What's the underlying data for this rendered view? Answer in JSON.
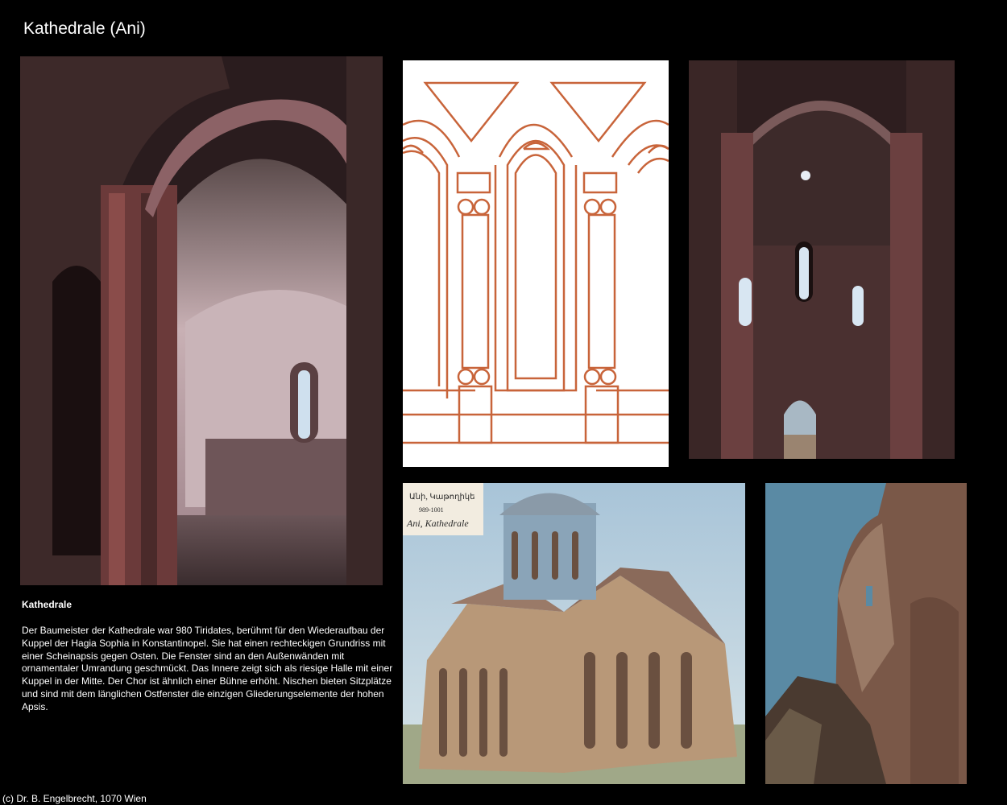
{
  "page": {
    "title": "Kathedrale (Ani)"
  },
  "images": {
    "interior_apse": "interior-apse-photo",
    "arch_drawing": "arch-drawing",
    "interior_nave": "interior-nave-photo",
    "reconstruction": "reconstruction-painting",
    "ruin": "ruin-photo"
  },
  "painting": {
    "label_line1": "Անի, Կաթողիկե",
    "label_line2": "989-1001",
    "label_line3": "Ani, Kathedrale"
  },
  "caption": {
    "heading": "Kathedrale",
    "body": "Der Baumeister der Kathedrale war 980 Tiridates, berühmt für den Wiederaufbau der Kuppel der Hagia Sophia in Konstantinopel. Sie hat einen rechteckigen Grundriss mit einer Scheinapsis gegen Osten. Die Fenster sind an den Außenwänden mit ornamentaler Umrandung geschmückt. Das Innere zeigt sich als riesige Halle mit einer Kuppel in der Mitte. Der Chor ist ähnlich einer Bühne erhöht. Nischen bieten Sitzplätze und sind mit dem länglichen Ostfenster die einzigen Gliederungselemente der hohen Apsis."
  },
  "footer": {
    "copyright": "(c) Dr. B. Engelbrecht, 1070 Wien"
  },
  "colors": {
    "background": "#000000",
    "drawing_stroke": "#c8643a",
    "stone_dark": "#3a2626",
    "stone_red": "#7a4040"
  }
}
